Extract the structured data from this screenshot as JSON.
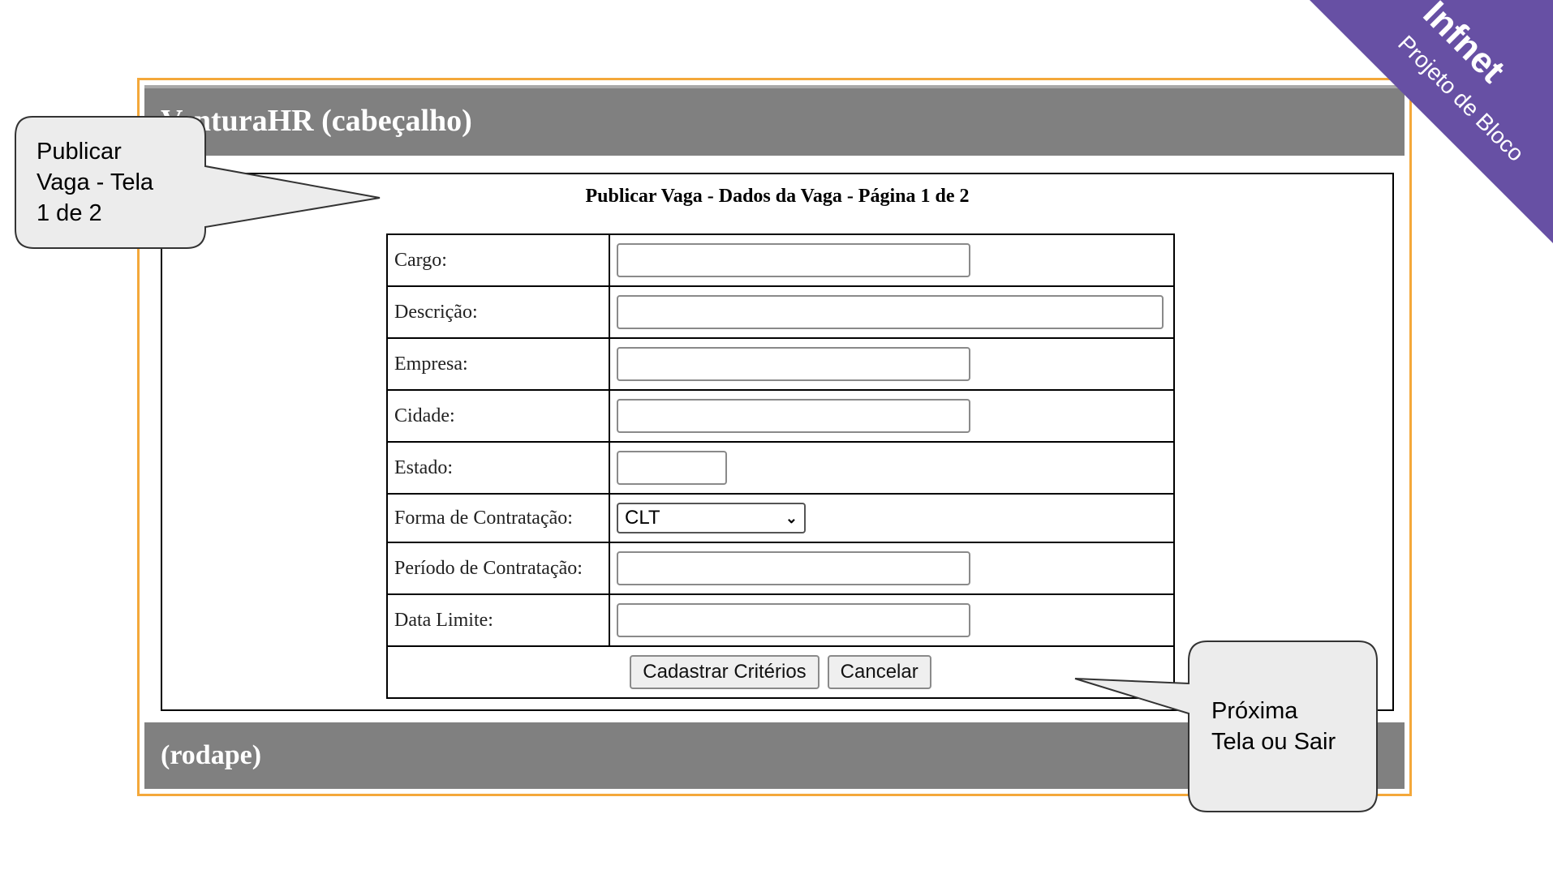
{
  "app": {
    "header_title": "VenturaHR (cabeçalho)",
    "footer_title": "(rodape)"
  },
  "form": {
    "title": "Publicar Vaga - Dados da Vaga - Página 1 de 2",
    "fields": {
      "cargo_label": "Cargo:",
      "descricao_label": "Descrição:",
      "empresa_label": "Empresa:",
      "cidade_label": "Cidade:",
      "estado_label": "Estado:",
      "forma_label": "Forma de Contratação:",
      "forma_value": "CLT",
      "periodo_label": "Período de Contratação:",
      "data_label": "Data Limite:"
    },
    "buttons": {
      "cadastrar": "Cadastrar Critérios",
      "cancelar": "Cancelar"
    }
  },
  "callouts": {
    "left": [
      "Publicar",
      "Vaga - Tela",
      "1 de 2"
    ],
    "right": [
      "Próxima",
      "Tela ou Sair"
    ]
  },
  "ribbon": {
    "brand": "Infnet",
    "subtitle": "Projeto de Bloco"
  },
  "colors": {
    "frame_border": "#f4a83a",
    "bar_gray": "#808080",
    "ribbon_purple": "#6750a4"
  }
}
